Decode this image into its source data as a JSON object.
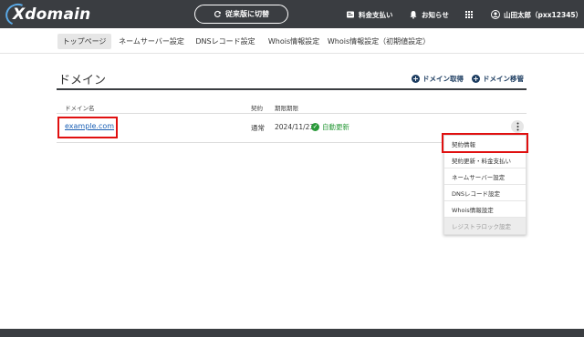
{
  "header": {
    "logo": "Xdomain",
    "switch_label": "従来版に切替",
    "pay_label": "料金支払い",
    "notice_label": "お知らせ",
    "user_label": "山田太郎（pxx12345）"
  },
  "subnav": {
    "items": [
      {
        "label": "トップページ"
      },
      {
        "label": "ネームサーバー設定"
      },
      {
        "label": "DNSレコード設定"
      },
      {
        "label": "Whois情報設定"
      },
      {
        "label": "Whois情報設定（初期値設定）"
      }
    ]
  },
  "main": {
    "title": "ドメイン",
    "acquire_label": "ドメイン取得",
    "transfer_label": "ドメイン移管",
    "columns": [
      "ドメイン名",
      "契約",
      "期限期限"
    ],
    "row": {
      "domain": "example.com",
      "contract": "通常",
      "expiry": "2024/11/23",
      "auto_renew": "自動更新"
    }
  },
  "menu": {
    "items": [
      {
        "label": "契約情報"
      },
      {
        "label": "契約更新・料金支払い"
      },
      {
        "label": "ネームサーバー設定"
      },
      {
        "label": "DNSレコード設定"
      },
      {
        "label": "Whois情報設定"
      },
      {
        "label": "レジストラロック設定"
      }
    ]
  },
  "colors": {
    "header_bg": "#3a3d41",
    "link": "#1a5fb4",
    "accent": "#1c3c60",
    "success": "#2a9a3a",
    "highlight": "#e01010"
  }
}
